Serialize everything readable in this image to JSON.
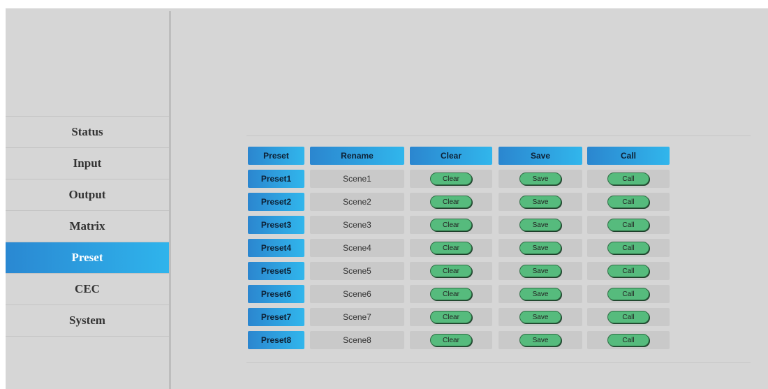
{
  "sidebar": {
    "items": [
      {
        "label": "Status",
        "active": false
      },
      {
        "label": "Input",
        "active": false
      },
      {
        "label": "Output",
        "active": false
      },
      {
        "label": "Matrix",
        "active": false
      },
      {
        "label": "Preset",
        "active": true
      },
      {
        "label": "CEC",
        "active": false
      },
      {
        "label": "System",
        "active": false
      }
    ]
  },
  "table": {
    "headers": [
      "Preset",
      "Rename",
      "Clear",
      "Save",
      "Call"
    ],
    "rows": [
      {
        "preset": "Preset1",
        "name": "Scene1",
        "clear": "Clear",
        "save": "Save",
        "call": "Call"
      },
      {
        "preset": "Preset2",
        "name": "Scene2",
        "clear": "Clear",
        "save": "Save",
        "call": "Call"
      },
      {
        "preset": "Preset3",
        "name": "Scene3",
        "clear": "Clear",
        "save": "Save",
        "call": "Call"
      },
      {
        "preset": "Preset4",
        "name": "Scene4",
        "clear": "Clear",
        "save": "Save",
        "call": "Call"
      },
      {
        "preset": "Preset5",
        "name": "Scene5",
        "clear": "Clear",
        "save": "Save",
        "call": "Call"
      },
      {
        "preset": "Preset6",
        "name": "Scene6",
        "clear": "Clear",
        "save": "Save",
        "call": "Call"
      },
      {
        "preset": "Preset7",
        "name": "Scene7",
        "clear": "Clear",
        "save": "Save",
        "call": "Call"
      },
      {
        "preset": "Preset8",
        "name": "Scene8",
        "clear": "Clear",
        "save": "Save",
        "call": "Call"
      }
    ]
  },
  "colors": {
    "page_background": "#d6d6d6",
    "accent_gradient_start": "#2b86cf",
    "accent_gradient_end": "#31b6ec",
    "cell_background": "#c9c9c9",
    "action_button": "#56bb7d"
  }
}
